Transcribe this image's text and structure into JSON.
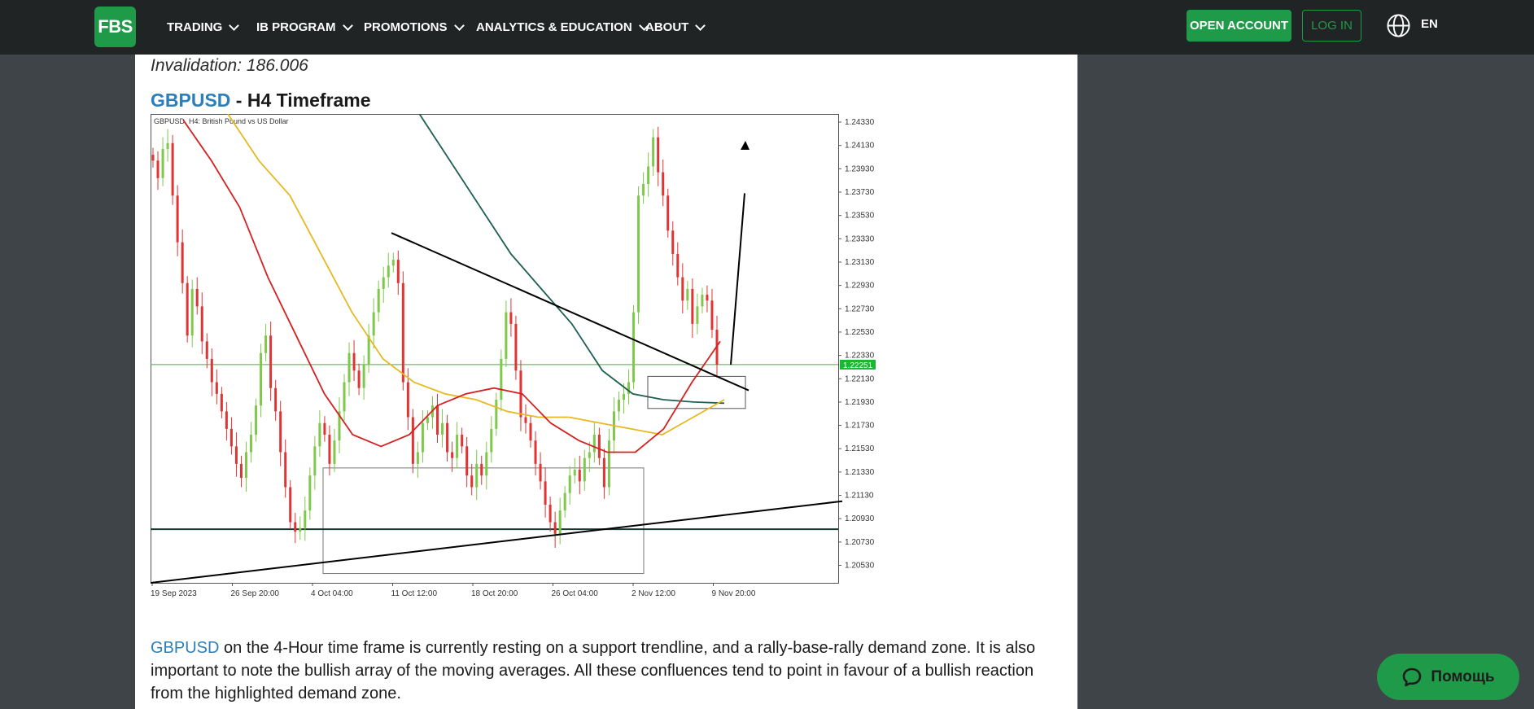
{
  "header": {
    "logo": "FBS",
    "nav": [
      {
        "label": "TRADING"
      },
      {
        "label": "IB PROGRAM"
      },
      {
        "label": "PROMOTIONS"
      },
      {
        "label": "ANALYTICS & EDUCATION"
      },
      {
        "label": "ABOUT"
      }
    ],
    "open_account": "OPEN ACCOUNT",
    "login": "LOG IN",
    "language": "EN"
  },
  "article": {
    "invalidation": "Invalidation: 186.006",
    "heading_pair": "GBPUSD",
    "heading_rest": " - H4 Timeframe",
    "body_pair": "GBPUSD",
    "body_text": " on the 4-Hour time frame is currently resting on a support trendline, and a rally-base-rally demand zone. It is also important to note the bullish array of the moving averages. All these confluences tend to point in favour of a bullish reaction from the highlighted demand zone."
  },
  "chart_data": {
    "type": "candlestick",
    "title": "GBPUSD, H4:  British Pound vs US Dollar",
    "x_tick_labels": [
      "19 Sep 2023",
      "26 Sep 20:00",
      "4 Oct 04:00",
      "11 Oct 12:00",
      "18 Oct 20:00",
      "26 Oct 04:00",
      "2 Nov 12:00",
      "9 Nov 20:00"
    ],
    "y_tick_labels": [
      "1.24330",
      "1.24130",
      "1.23930",
      "1.23730",
      "1.23530",
      "1.23330",
      "1.23130",
      "1.22930",
      "1.22730",
      "1.22530",
      "1.22330",
      "1.22130",
      "1.21930",
      "1.21730",
      "1.21530",
      "1.21330",
      "1.21130",
      "1.20930",
      "1.20730",
      "1.20530"
    ],
    "ylim": [
      1.2038,
      1.244
    ],
    "current_price": "1.22251",
    "close_series": [
      1.24,
      1.2385,
      1.241,
      1.2415,
      1.237,
      1.233,
      1.2295,
      1.225,
      1.229,
      1.2275,
      1.2245,
      1.223,
      1.221,
      1.22,
      1.2185,
      1.217,
      1.2155,
      1.214,
      1.2128,
      1.215,
      1.2165,
      1.219,
      1.2235,
      1.225,
      1.2205,
      1.2185,
      1.215,
      1.212,
      1.209,
      1.2082,
      1.2085,
      1.21,
      1.213,
      1.2155,
      1.2175,
      1.2165,
      1.214,
      1.216,
      1.2185,
      1.221,
      1.2235,
      1.222,
      1.2205,
      1.2225,
      1.225,
      1.227,
      1.229,
      1.23,
      1.231,
      1.2315,
      1.2295,
      1.221,
      1.218,
      1.214,
      1.215,
      1.2175,
      1.218,
      1.219,
      1.2165,
      1.2175,
      1.215,
      1.2145,
      1.2165,
      1.2155,
      1.213,
      1.212,
      1.214,
      1.213,
      1.215,
      1.217,
      1.2195,
      1.223,
      1.227,
      1.226,
      1.222,
      1.218,
      1.2175,
      1.216,
      1.214,
      1.2125,
      1.2105,
      1.209,
      1.208,
      1.21,
      1.2115,
      1.213,
      1.2135,
      1.2125,
      1.2145,
      1.215,
      1.2165,
      1.2145,
      1.212,
      1.216,
      1.2185,
      1.2195,
      1.22,
      1.221,
      1.227,
      1.237,
      1.238,
      1.2395,
      1.242,
      1.239,
      1.237,
      1.234,
      1.232,
      1.23,
      1.228,
      1.229,
      1.226,
      1.2275,
      1.2285,
      1.228,
      1.2255,
      1.2225
    ],
    "series": [
      {
        "name": "",
        "color": "#1e5f52",
        "values": [
          1.256,
          1.252,
          1.249,
          1.244,
          1.24,
          1.236,
          1.232,
          1.229,
          1.226,
          1.222,
          1.22,
          1.2195,
          1.2193,
          1.2192
        ]
      },
      {
        "name": "",
        "color": "#e8b820",
        "values": [
          1.244,
          1.24,
          1.237,
          1.232,
          1.227,
          1.223,
          1.221,
          1.22,
          1.2195,
          1.2185,
          1.218,
          1.218,
          1.2175,
          1.217,
          1.2165,
          1.218,
          1.2195
        ]
      },
      {
        "name": "",
        "color": "#d62020",
        "values": [
          1.2435,
          1.24,
          1.236,
          1.23,
          1.225,
          1.22,
          1.2165,
          1.2155,
          1.2165,
          1.219,
          1.22,
          1.2205,
          1.22,
          1.2175,
          1.216,
          1.215,
          1.215,
          1.217,
          1.221,
          1.2245
        ]
      }
    ],
    "horizontal_level": 1.2084,
    "grid": false
  }
}
